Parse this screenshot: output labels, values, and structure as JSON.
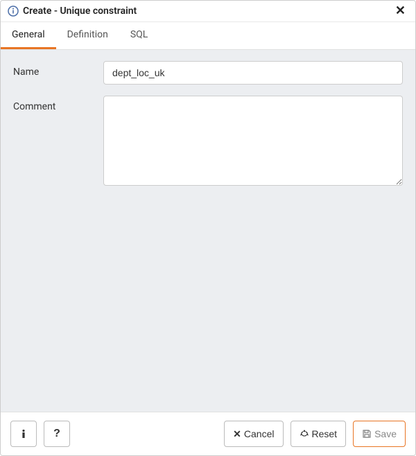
{
  "header": {
    "title": "Create - Unique constraint"
  },
  "tabs": [
    {
      "label": "General",
      "active": true
    },
    {
      "label": "Definition",
      "active": false
    },
    {
      "label": "SQL",
      "active": false
    }
  ],
  "form": {
    "name_label": "Name",
    "name_value": "dept_loc_uk",
    "comment_label": "Comment",
    "comment_value": ""
  },
  "footer": {
    "cancel_label": "Cancel",
    "reset_label": "Reset",
    "save_label": "Save"
  }
}
